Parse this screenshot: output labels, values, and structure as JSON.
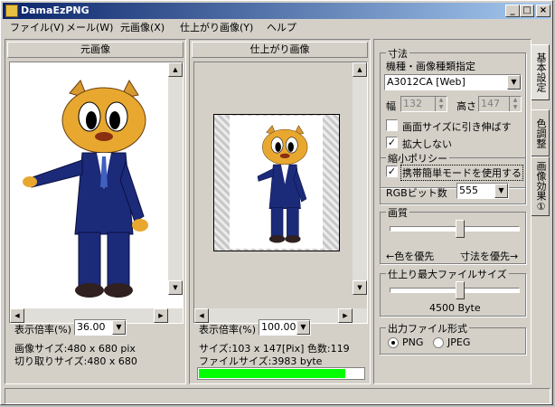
{
  "window": {
    "title": "DamaEzPNG",
    "min": "_",
    "max": "□",
    "close": "×"
  },
  "menu": [
    "ファイル(V)",
    "メール(W)",
    "元画像(X)",
    "仕上がり画像(Y)",
    "ヘルプ"
  ],
  "left_panel": {
    "header": "元画像",
    "zoom_label": "表示倍率(%)",
    "zoom_value": "36.00",
    "image_size": "画像サイズ:480 x 680 pix",
    "crop_size": "切り取りサイズ:480 x 680"
  },
  "mid_panel": {
    "header": "仕上がり画像",
    "zoom_label": "表示倍率(%)",
    "zoom_value": "100.00",
    "size_info": "サイズ:103 x 147[Pix] 色数:119",
    "file_size": "ファイルサイズ:3983 byte",
    "progress": 0.89
  },
  "settings": {
    "dims_group": "寸法",
    "model_label": "機種・画像種類指定",
    "model_value": "A3012CA [Web]",
    "width_label": "幅",
    "width_value": "132",
    "height_label": "高さ",
    "height_value": "147",
    "stretch_label": "画面サイズに引き伸ばす",
    "stretch_checked": false,
    "no_enlarge_label": "拡大しない",
    "no_enlarge_checked": true,
    "shrink_group": "縮小ポリシー",
    "simple_mode_label": "携帯簡単モードを使用する",
    "simple_mode_checked": true,
    "rgb_label": "RGBビット数",
    "rgb_value": "555",
    "quality_group": "画質",
    "quality_left": "←色を優先",
    "quality_right": "寸法を優先→",
    "quality_level": 0.55,
    "maxsize_group": "仕上り最大ファイルサイズ",
    "maxsize_value": "4500 Byte",
    "maxsize_level": 0.55,
    "format_group": "出力ファイル形式",
    "format_png": "PNG",
    "format_jpeg": "JPEG",
    "format_selected": "PNG"
  },
  "tabs": [
    "基本設定",
    "色調整",
    "画像効果①"
  ],
  "colors": {
    "progress": "#00ff00",
    "title_start": "#0a246a",
    "title_end": "#a6caf0"
  }
}
